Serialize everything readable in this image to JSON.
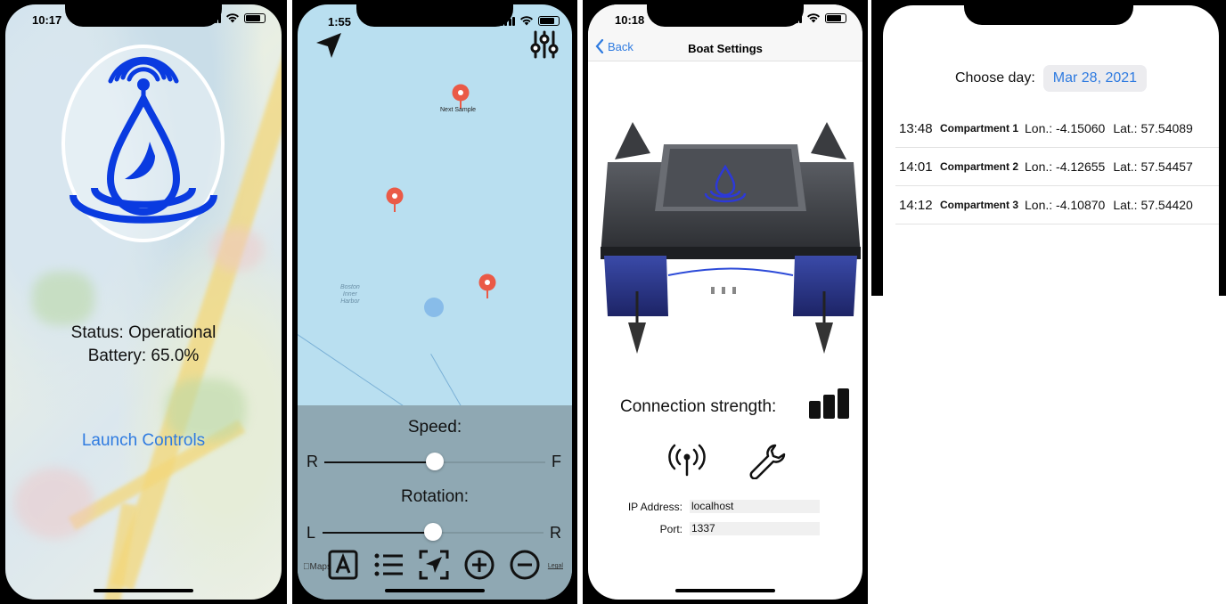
{
  "phone1": {
    "time": "10:17",
    "status": "Status: Operational",
    "battery": "Battery: 65.0%",
    "launch_label": "Launch Controls"
  },
  "phone2": {
    "time": "1:55",
    "pin_label": "Next Sample",
    "map_label": "Boston\nInner\nHarbor",
    "speed_label": "Speed:",
    "speed_left": "R",
    "speed_right": "F",
    "speed_value": 0.5,
    "rotation_label": "Rotation:",
    "rotation_left": "L",
    "rotation_right": "R",
    "rotation_value": 0.5,
    "maps_attribution": "Maps",
    "legal": "Legal",
    "toolbar": [
      "text-icon",
      "list-icon",
      "locate-icon",
      "plus-icon",
      "minus-icon"
    ]
  },
  "phone3": {
    "time": "10:18",
    "back_label": "Back",
    "title": "Boat Settings",
    "connection_label": "Connection strength:",
    "ip_label": "IP Address:",
    "ip_value": "localhost",
    "port_label": "Port:",
    "port_value": "1337"
  },
  "phone4": {
    "choose_day_label": "Choose day:",
    "date_value": "Mar 28, 2021",
    "rows": [
      {
        "time": "13:48",
        "name": "Compartment 1",
        "lon": "Lon.: -4.15060",
        "lat": "Lat.: 57.54089"
      },
      {
        "time": "14:01",
        "name": "Compartment 2",
        "lon": "Lon.: -4.12655",
        "lat": "Lat.: 57.54457"
      },
      {
        "time": "14:12",
        "name": "Compartment 3",
        "lon": "Lon.: -4.10870",
        "lat": "Lat.: 57.54420"
      }
    ]
  },
  "colors": {
    "accent": "#2f7be0",
    "logo_blue": "#0a3be0",
    "map_water": "#b9dff0",
    "pin_red": "#ea5a47",
    "control_panel": "#8fa8b3"
  }
}
